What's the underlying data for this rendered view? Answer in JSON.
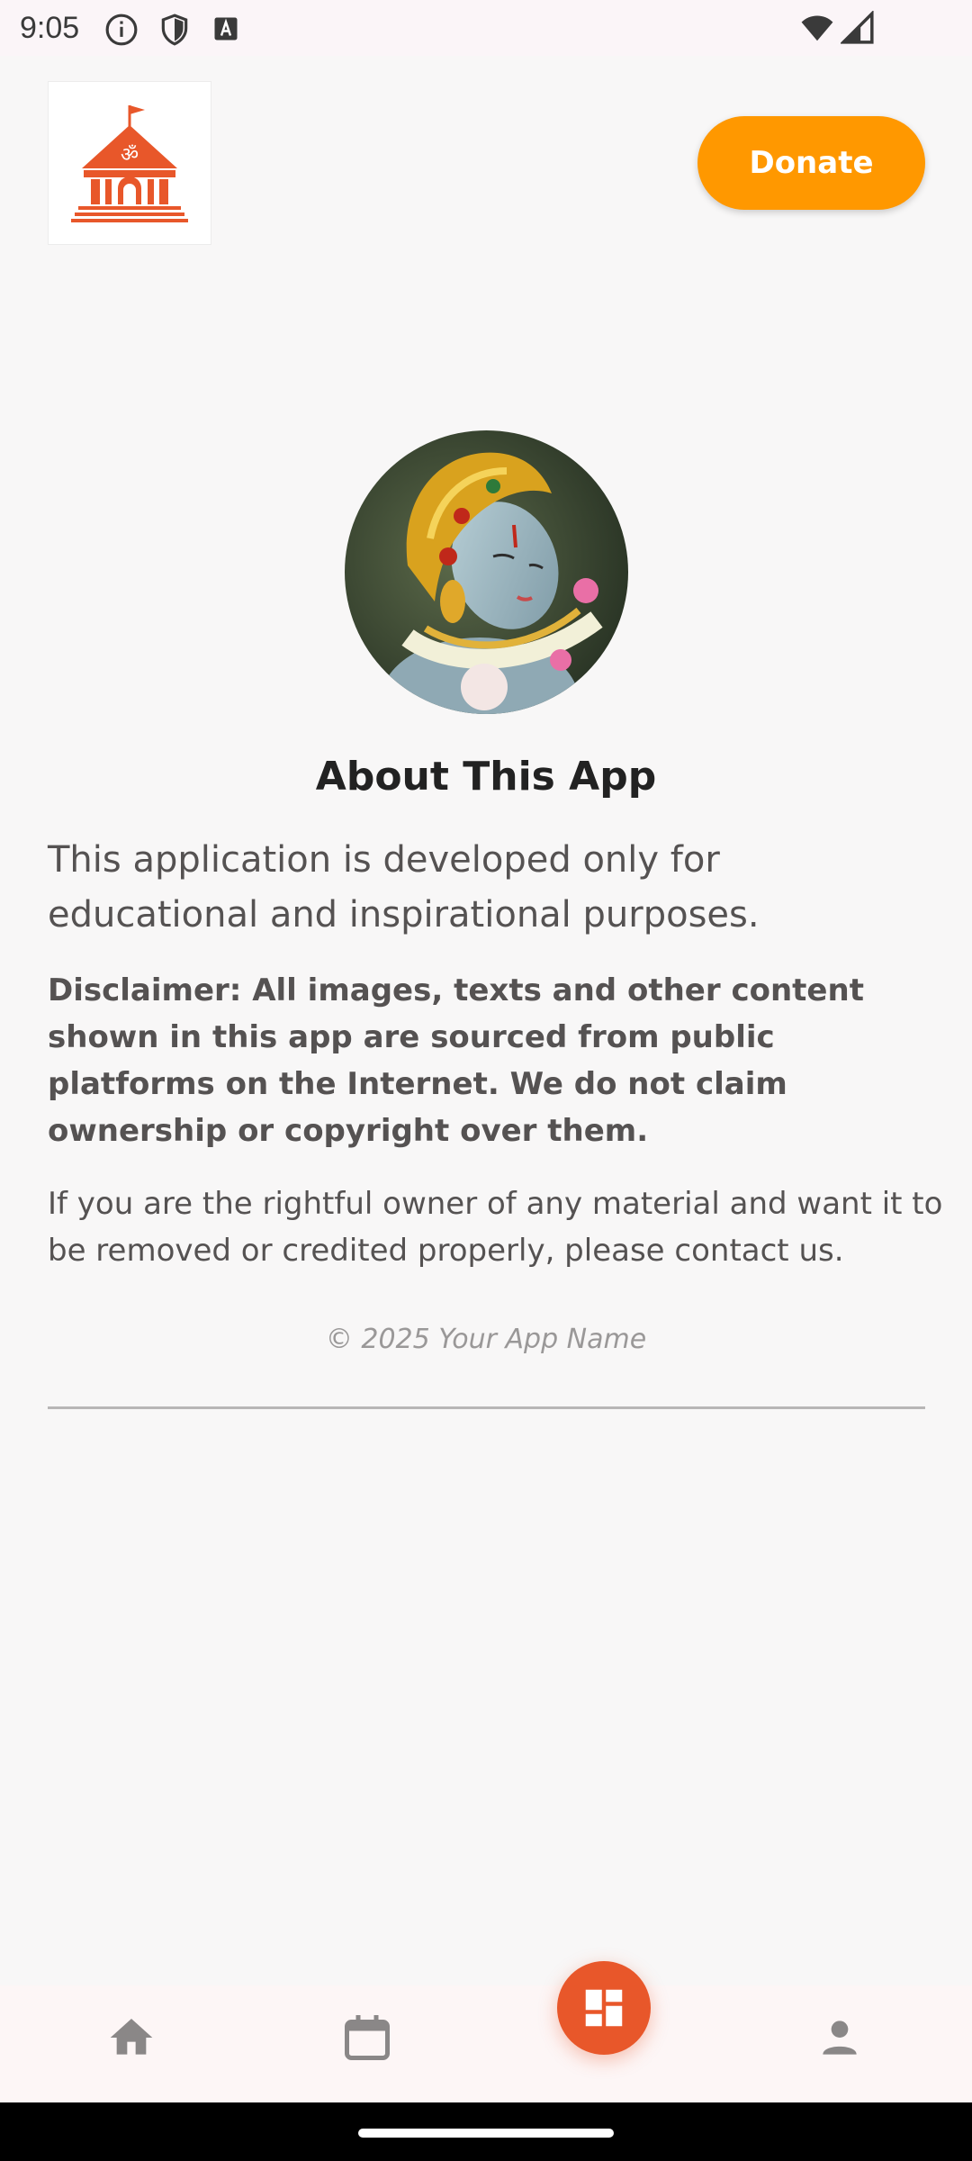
{
  "status_bar": {
    "time": "9:05"
  },
  "header": {
    "logo_icon": "temple-om-icon",
    "donate_label": "Donate"
  },
  "about": {
    "title": "About This App",
    "intro": "This application is developed only for educational and inspirational purposes.",
    "disclaimer": "Disclaimer: All images, texts and other content shown in this app are sourced from public platforms on the Internet. We do not claim ownership or copyright over them.",
    "owner_notice": "If you are the rightful owner of any material and want it to be removed or credited properly, please contact us.",
    "copyright": "© 2025 Your App Name"
  },
  "bottom_nav": {
    "items": [
      {
        "icon": "home-icon"
      },
      {
        "icon": "calendar-icon"
      },
      {
        "icon": "dashboard-icon",
        "active": true
      },
      {
        "icon": "person-icon"
      }
    ]
  },
  "colors": {
    "accent": "#e8572a",
    "donate": "#ff9800",
    "background": "#f8f7f7"
  }
}
